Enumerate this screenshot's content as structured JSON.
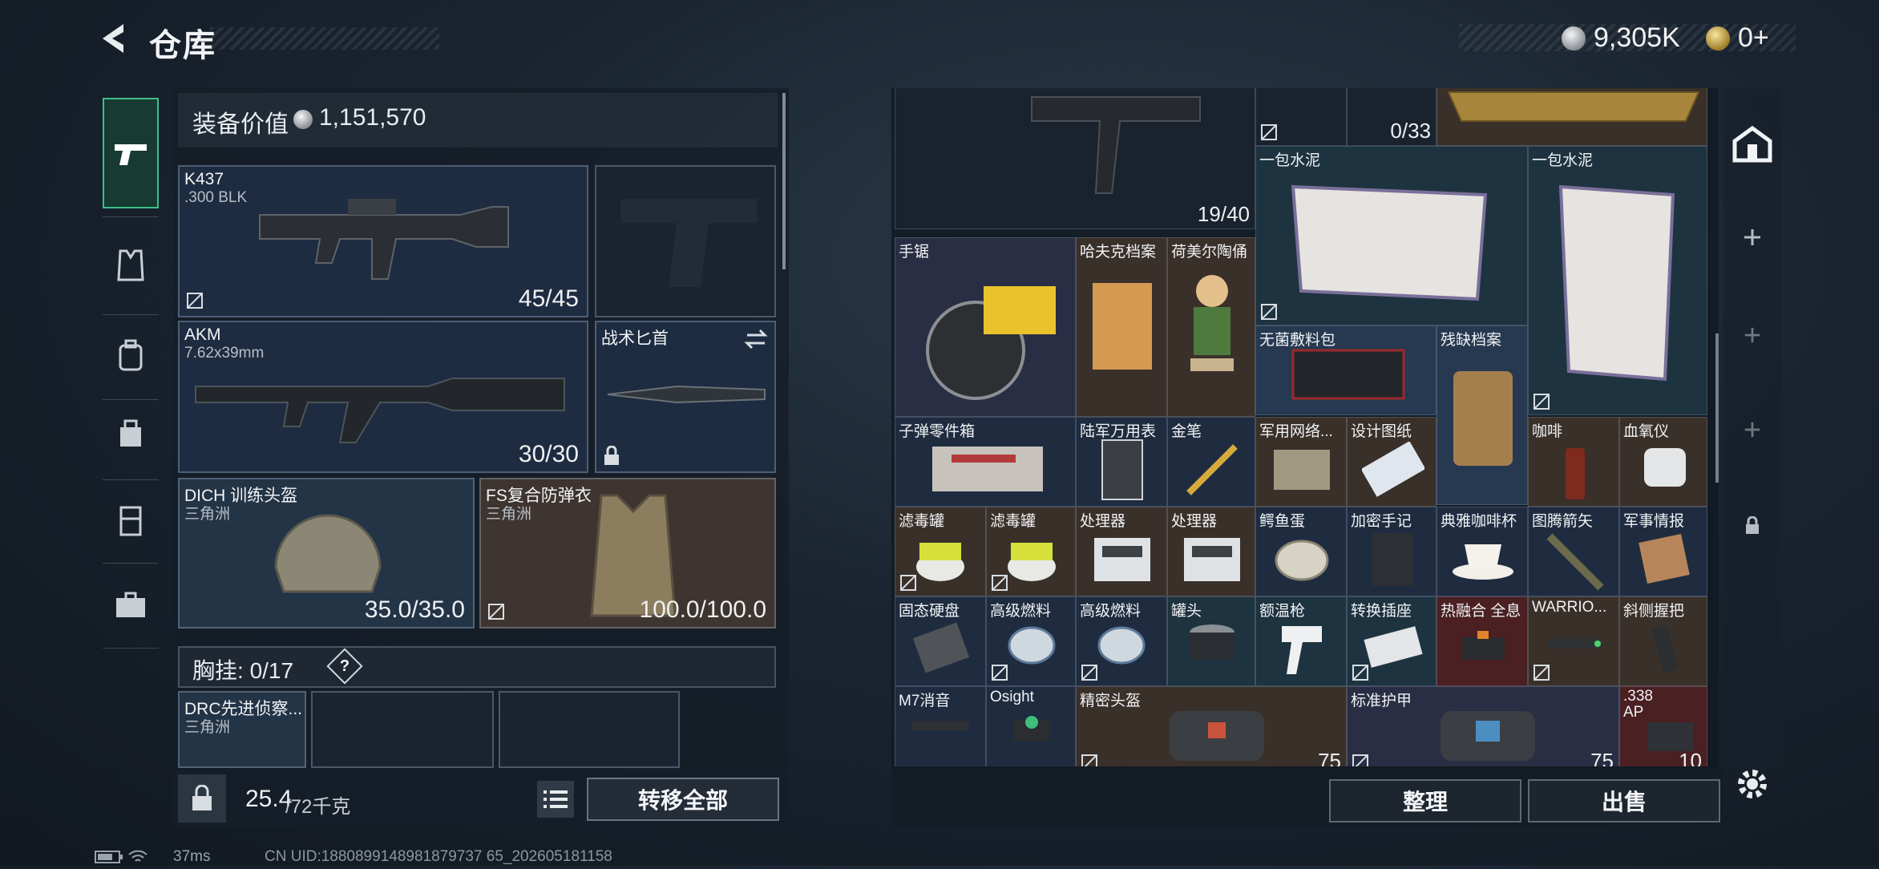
{
  "header": {
    "title": "仓库",
    "currency_silver": "9,305K",
    "currency_gold": "0+"
  },
  "loadout": {
    "equip_value_label": "装备价值",
    "equip_value": "1,151,570",
    "primary": {
      "name": "K437",
      "ammo": ".300 BLK",
      "count": "45/45"
    },
    "secondary": {
      "name": "AKM",
      "ammo": "7.62x39mm",
      "count": "30/30"
    },
    "melee": {
      "name": "战术匕首"
    },
    "helmet": {
      "name": "DICH 训练头盔",
      "origin": "三角洲",
      "durability": "35.0/35.0"
    },
    "armor": {
      "name": "FS复合防弹衣",
      "origin": "三角洲",
      "durability": "100.0/100.0"
    },
    "chest": {
      "label": "胸挂:",
      "count": "0/17",
      "help": "?"
    },
    "rig": {
      "name": "DRC先进侦察...",
      "origin": "三角洲"
    },
    "weight_value": "25.4",
    "weight_unit": "/72千克",
    "transfer_all": "转移全部"
  },
  "storage": {
    "items": [
      {
        "key": "smg",
        "name": "",
        "count": "19/40"
      },
      {
        "key": "mag",
        "name": "",
        "count": "0/33"
      },
      {
        "key": "cement1",
        "name": "一包水泥",
        "count": ""
      },
      {
        "key": "cement2",
        "name": "一包水泥",
        "count": ""
      },
      {
        "key": "saw",
        "name": "手锯",
        "count": ""
      },
      {
        "key": "hfile",
        "name": "哈夫克档案",
        "count": ""
      },
      {
        "key": "hummel",
        "name": "荷美尔陶俑",
        "count": ""
      },
      {
        "key": "medkit",
        "name": "无菌敷料包",
        "count": ""
      },
      {
        "key": "damaged",
        "name": "残缺档案",
        "count": ""
      },
      {
        "key": "bullets",
        "name": "子弹零件箱",
        "count": ""
      },
      {
        "key": "mmeter",
        "name": "陆军万用表",
        "count": ""
      },
      {
        "key": "pen",
        "name": "金笔",
        "count": ""
      },
      {
        "key": "netcard",
        "name": "军用网络...",
        "count": ""
      },
      {
        "key": "blueprint",
        "name": "设计图纸",
        "count": ""
      },
      {
        "key": "coffee",
        "name": "咖啡",
        "count": ""
      },
      {
        "key": "oximeter",
        "name": "血氧仪",
        "count": ""
      },
      {
        "key": "filter1",
        "name": "滤毒罐",
        "count": ""
      },
      {
        "key": "filter2",
        "name": "滤毒罐",
        "count": ""
      },
      {
        "key": "cpu1",
        "name": "处理器",
        "count": ""
      },
      {
        "key": "cpu2",
        "name": "处理器",
        "count": ""
      },
      {
        "key": "egg",
        "name": "鳄鱼蛋",
        "count": ""
      },
      {
        "key": "notebook",
        "name": "加密手记",
        "count": ""
      },
      {
        "key": "cup",
        "name": "典雅咖啡杯",
        "count": ""
      },
      {
        "key": "arrow",
        "name": "图腾箭矢",
        "count": ""
      },
      {
        "key": "intel",
        "name": "军事情报",
        "count": ""
      },
      {
        "key": "ssd",
        "name": "固态硬盘",
        "count": ""
      },
      {
        "key": "fuel1",
        "name": "高级燃料",
        "count": ""
      },
      {
        "key": "fuel2",
        "name": "高级燃料",
        "count": ""
      },
      {
        "key": "can",
        "name": "罐头",
        "count": ""
      },
      {
        "key": "thermo",
        "name": "额温枪",
        "count": ""
      },
      {
        "key": "socket",
        "name": "转换插座",
        "count": ""
      },
      {
        "key": "fusion",
        "name": "热融合 全息",
        "count": ""
      },
      {
        "key": "warrior",
        "name": "WARRIO...",
        "count": ""
      },
      {
        "key": "grip",
        "name": "斜侧握把",
        "count": ""
      },
      {
        "key": "m7",
        "name": "M7消音",
        "count": ""
      },
      {
        "key": "osight",
        "name": "Osight",
        "count": ""
      },
      {
        "key": "phelmet",
        "name": "精密头盔",
        "count": "75"
      },
      {
        "key": "sarmor",
        "name": "标准护甲",
        "count": "75"
      },
      {
        "key": "ap338",
        "name": ".338 AP",
        "count": "10"
      }
    ],
    "sort": "整理",
    "sell": "出售"
  },
  "status": {
    "ping": "37ms",
    "uid": "CN UID:1880899148981879737 65_202605181158"
  }
}
